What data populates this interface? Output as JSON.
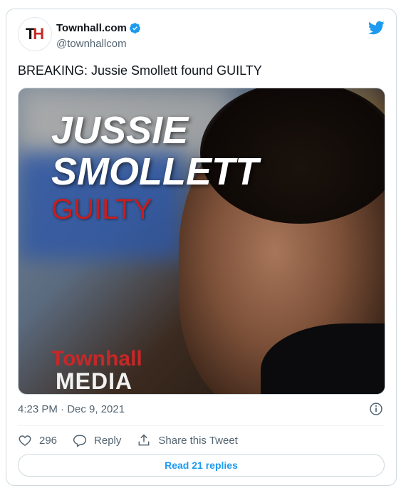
{
  "account": {
    "display_name": "Townhall.com",
    "handle": "@townhallcom",
    "avatar_text_t": "T",
    "avatar_text_h": "H"
  },
  "tweet": {
    "text": "BREAKING: Jussie Smollett found GUILTY",
    "timestamp": "4:23 PM · Dec 9, 2021"
  },
  "media": {
    "headline_line1": "JUSSIE",
    "headline_line2": "SMOLLETT",
    "headline_line3": "GUILTY",
    "watermark_line1": "Townhall",
    "watermark_line2": "MEDIA"
  },
  "actions": {
    "likes": "296",
    "reply_label": "Reply",
    "share_label": "Share this Tweet"
  },
  "read_replies_label": "Read 21 replies",
  "icons": {
    "brand": "twitter-bird-icon",
    "verified": "verified-badge-icon",
    "info": "info-icon",
    "like": "heart-icon",
    "reply": "reply-bubble-icon",
    "share": "share-upload-icon"
  },
  "colors": {
    "twitter_blue": "#1d9bf0",
    "guilty_red": "#c91d1d"
  }
}
